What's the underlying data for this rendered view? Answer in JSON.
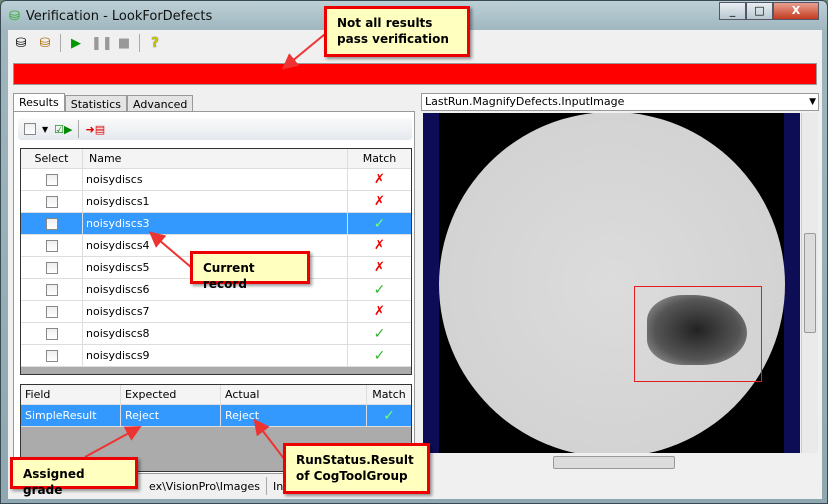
{
  "window": {
    "title": "Verification - LookForDefects",
    "controls": [
      "_",
      "□",
      "X"
    ]
  },
  "toolbar": {
    "icons": [
      "run-database-icon",
      "edit-database-icon",
      "play-icon",
      "pause-icon",
      "stop-icon",
      "help-icon"
    ]
  },
  "status_color": "#ff0000",
  "tabs": [
    {
      "label": "Results",
      "active": true
    },
    {
      "label": "Statistics"
    },
    {
      "label": "Advanced"
    }
  ],
  "results": {
    "columns": [
      "Select",
      "Name",
      "Match"
    ],
    "rows": [
      {
        "name": "noisydiscs",
        "match": "fail"
      },
      {
        "name": "noisydiscs1",
        "match": "fail"
      },
      {
        "name": "noisydiscs3",
        "match": "pass",
        "selected": true
      },
      {
        "name": "noisydiscs4",
        "match": "fail"
      },
      {
        "name": "noisydiscs5",
        "match": "fail"
      },
      {
        "name": "noisydiscs6",
        "match": "pass"
      },
      {
        "name": "noisydiscs7",
        "match": "fail"
      },
      {
        "name": "noisydiscs8",
        "match": "pass"
      },
      {
        "name": "noisydiscs9",
        "match": "pass"
      }
    ]
  },
  "fields": {
    "columns": [
      "Field",
      "Expected",
      "Actual",
      "Match"
    ],
    "rows": [
      {
        "field": "SimpleResult",
        "expected": "Reject",
        "actual": "Reject",
        "match": "pass"
      }
    ]
  },
  "statusbar": {
    "path": "ex\\VisionPro\\Images",
    "extra": "Input"
  },
  "image_selector": "LastRun.MagnifyDefects.InputImage",
  "callouts": {
    "status": "Not all results pass verification",
    "current": "Current record",
    "grade": "Assigned grade",
    "runstatus": "RunStatus.Result of CogToolGroup"
  }
}
